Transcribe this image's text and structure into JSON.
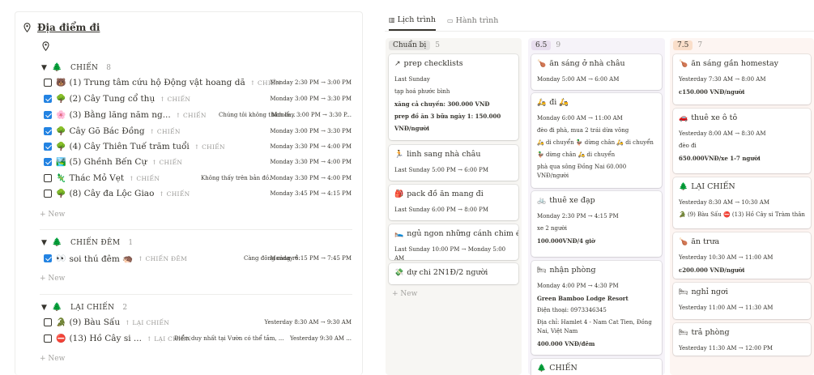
{
  "left": {
    "title": "Địa điểm đi",
    "groups": [
      {
        "name": "CHIẾN",
        "count": "8",
        "rows": [
          {
            "checked": false,
            "emoji": "🐻",
            "name": "(1) Trung tâm cứu hộ Động vật hoang dã",
            "tag": "CHIẾN",
            "note": "",
            "time": "Monday 2:30 PM → 3:00 PM"
          },
          {
            "checked": true,
            "emoji": "🌳",
            "name": "(2) Cây Tung cổ thụ",
            "tag": "CHIẾN",
            "note": "",
            "time": "Monday 3:00 PM → 3:30 PM"
          },
          {
            "checked": true,
            "emoji": "🌸",
            "name": "(3) Bằng lăng năm ng...",
            "tag": "CHIẾN",
            "note": "Chúng tôi không thích lắ...",
            "time": "Monday 3:00 PM → 3:30 P..."
          },
          {
            "checked": true,
            "emoji": "🌳",
            "name": "Cây Gõ Bác Đồng",
            "tag": "CHIẾN",
            "note": "",
            "time": "Monday 3:00 PM → 3:30 PM"
          },
          {
            "checked": true,
            "emoji": "🌳",
            "name": "(4) Cây Thiên Tuế trăm tuổi",
            "tag": "CHIẾN",
            "note": "",
            "time": "Monday 3:30 PM → 4:00 PM"
          },
          {
            "checked": true,
            "emoji": "🏞️",
            "name": "(5) Ghềnh Bến Cự",
            "tag": "CHIẾN",
            "note": "",
            "time": "Monday 3:30 PM → 4:00 PM"
          },
          {
            "checked": false,
            "emoji": "🦎",
            "name": "Thác Mỏ Vẹt",
            "tag": "CHIẾN",
            "note": "Không thấy trên bản đồ.",
            "time": "Monday 3:30 PM → 4:00 PM"
          },
          {
            "checked": false,
            "emoji": "🌳",
            "name": "(8) Cây đa Lộc Giao",
            "tag": "CHIẾN",
            "note": "",
            "time": "Monday 3:45 PM → 4:15 PM"
          }
        ]
      },
      {
        "name": "CHIẾN ĐÊM",
        "count": "1",
        "rows": [
          {
            "checked": true,
            "emoji": "👀",
            "name": "soi thú đêm 🦔",
            "tag": "CHIẾN ĐÊM",
            "note": "Càng đông càng rẻ.",
            "time": "Monday 6:15 PM → 7:45 PM"
          }
        ]
      },
      {
        "name": "LẠI CHIẾN",
        "count": "2",
        "rows": [
          {
            "checked": false,
            "emoji": "🐊",
            "name": "(9) Bàu Sấu",
            "tag": "LẠI CHIẾN",
            "note": "",
            "time": "Yesterday 8:30 AM → 9:30 AM"
          },
          {
            "checked": false,
            "emoji": "⛔",
            "name": "(13) Hồ Cây si ...",
            "tag": "LẠI CHIẾN",
            "note": "Điểm duy nhất tại Vườn có thể tắm, ...",
            "time": "Yesterday 9:30 AM ..."
          }
        ]
      }
    ],
    "new_label": "New"
  },
  "tabs": {
    "schedule": "Lịch trình",
    "journey": "Hành trình"
  },
  "columns": [
    {
      "label": "Chuẩn bị",
      "count": "5",
      "new_label": "New",
      "cards": [
        {
          "icon": "↗",
          "title": "prep checklists",
          "lines": [
            "Last Sunday",
            "tạp hoá phước bình",
            "xăng cả chuyến: 300.000 VNĐ",
            "prep đồ ăn 3 bữa ngày 1: 150.000",
            "VNĐ/người"
          ]
        },
        {
          "icon": "🏃",
          "title": "linh sang nhà châu",
          "lines": [
            "Last Sunday 5:00 PM → 6:00 PM"
          ]
        },
        {
          "icon": "🎒",
          "title": "pack đồ ăn mang đi",
          "lines": [
            "Last Sunday 6:00 PM → 8:00 PM"
          ]
        },
        {
          "icon": "🛌",
          "title": "ngủ ngon những cánh chim én",
          "lines": [
            "Last Sunday 10:00 PM → Monday 5:00 AM"
          ]
        },
        {
          "icon": "💸",
          "title": "dự chi 2N1Đ/2 người",
          "lines": []
        }
      ]
    },
    {
      "label": "6.5",
      "count": "9",
      "cards": [
        {
          "icon": "🍗",
          "title": "ăn sáng ở nhà châu",
          "lines": [
            "Monday 5:00 AM → 6:00 AM"
          ]
        },
        {
          "icon": "🛵",
          "title": "đi 🛵",
          "lines": [
            "Monday 6:00 AM → 11:00 AM",
            "đèo đi phà, mua 2 trái dừa vông",
            "🛵 di chuyển  🦆 dừng chân  🛵 di chuyển",
            "🦆 dừng chân  🛵 di chuyển",
            "phà qua sông Đồng Nai 60.000 VNĐ/người"
          ]
        },
        {
          "icon": "🚲",
          "title": "thuê xe đạp",
          "lines": [
            "Monday 2:30 PM → 4:15 PM",
            "xe 2 người",
            "100.000VNĐ/4 giờ"
          ]
        },
        {
          "icon": "🛏",
          "title": "nhận phòng",
          "lines": [
            "Monday 4:00 PM → 4:30 PM",
            "Green Bamboo Lodge Resort",
            "Điện thoại: 0973346345",
            "Địa chỉ: Hamlet 4 - Nam Cat Tien, Đồng Nai, Việt Nam",
            "400.000 VNĐ/đêm"
          ]
        },
        {
          "icon": "🌲",
          "title": "CHIẾN",
          "lines": []
        }
      ]
    },
    {
      "label": "7.5",
      "count": "7",
      "cards": [
        {
          "icon": "🍗",
          "title": "ăn sáng gần homestay",
          "lines": [
            "Yesterday 7:30 AM → 8:00 AM",
            "c150.000 VNĐ/người"
          ]
        },
        {
          "icon": "🚗",
          "title": "thuê xe ô tô",
          "lines": [
            "Yesterday 8:00 AM → 8:30 AM",
            "đèo đi",
            "650.000VNĐ/xe 1-7 người"
          ]
        },
        {
          "icon": "🌲",
          "title": "LẠI CHIẾN",
          "lines": [
            "Yesterday 8:30 AM → 10:30 AM",
            "🐊 (9) Bàu Sấu  ⛔ (13) Hồ Cây si Tràm thân"
          ]
        },
        {
          "icon": "🍗",
          "title": "ăn trưa",
          "lines": [
            "Yesterday 10:30 AM → 11:00 AM",
            "c200.000 VNĐ/người"
          ]
        },
        {
          "icon": "🛏",
          "title": "nghỉ ngơi",
          "lines": [
            "Yesterday 11:00 AM → 11:30 AM"
          ]
        },
        {
          "icon": "🛏",
          "title": "trả phòng",
          "lines": [
            "Yesterday 11:30 AM → 12:00 PM"
          ]
        }
      ]
    }
  ],
  "colors": {
    "col1_bg": "#f7f6f3",
    "col1_chip": "#e3e2e0",
    "col2_bg": "#f6f3f9",
    "col2_chip": "#e8deee",
    "col3_bg": "#fdf5f2",
    "col3_chip": "#fadec9",
    "check": "#2383e2"
  }
}
